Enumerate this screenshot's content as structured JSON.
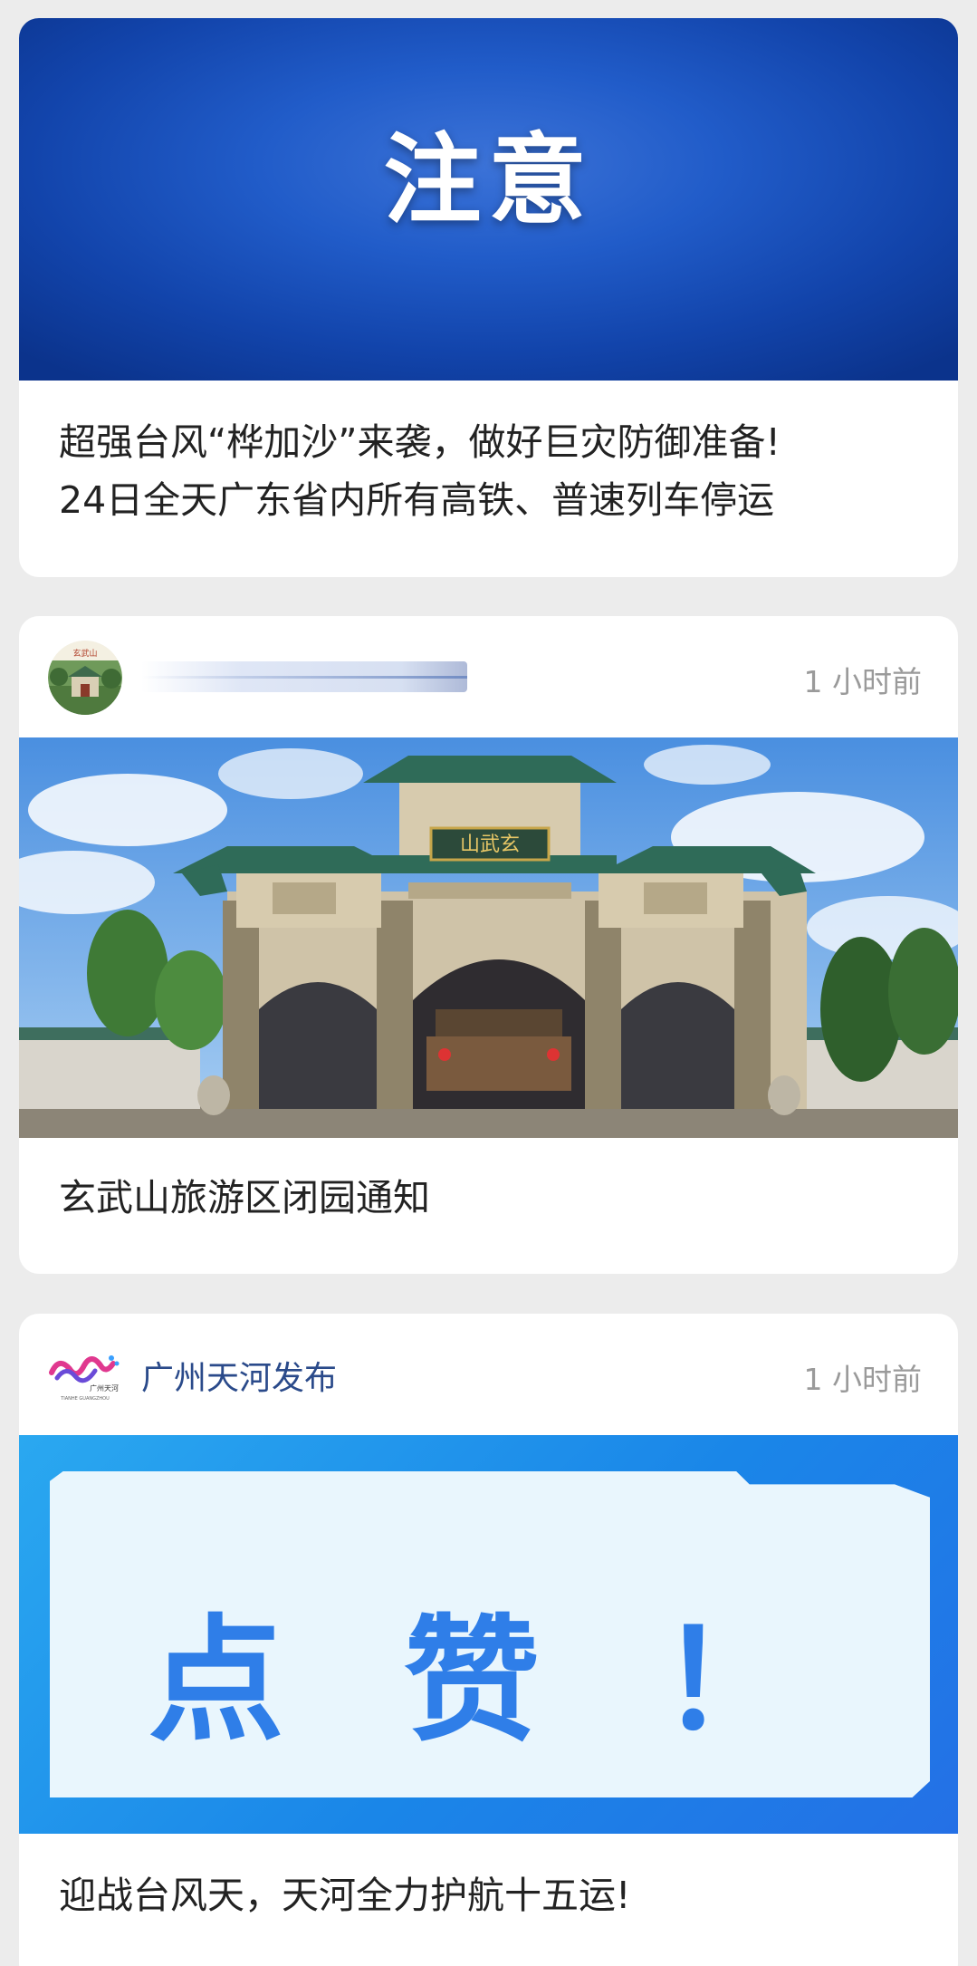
{
  "cards": [
    {
      "banner_text": "注意",
      "headline_lines": [
        "超强台风“桦加沙”来袭，做好巨灾防御准备!",
        "24日全天广东省内所有高铁、普速列车停运"
      ]
    },
    {
      "source": "",
      "time": "1 小时前",
      "headline": "玄武山旅游区闭园通知",
      "avatar_sign_text": "玄武山",
      "photo_plaque_text": "山武玄"
    },
    {
      "source": "广州天河发布",
      "time": "1 小时前",
      "logo_text": "广州天河",
      "logo_subtext": "TIANHE GUANGZHOU",
      "banner_text": "点 赞 ！",
      "headline": "迎战台风天，天河全力护航十五运!"
    }
  ],
  "colors": {
    "background": "#ececec",
    "card": "#ffffff",
    "notice_banner": "#1a4fb8",
    "like_banner": "#1a86e8",
    "like_text": "#2f7ee8",
    "source_name": "#2a4a8a",
    "time": "#9a9a9a"
  }
}
